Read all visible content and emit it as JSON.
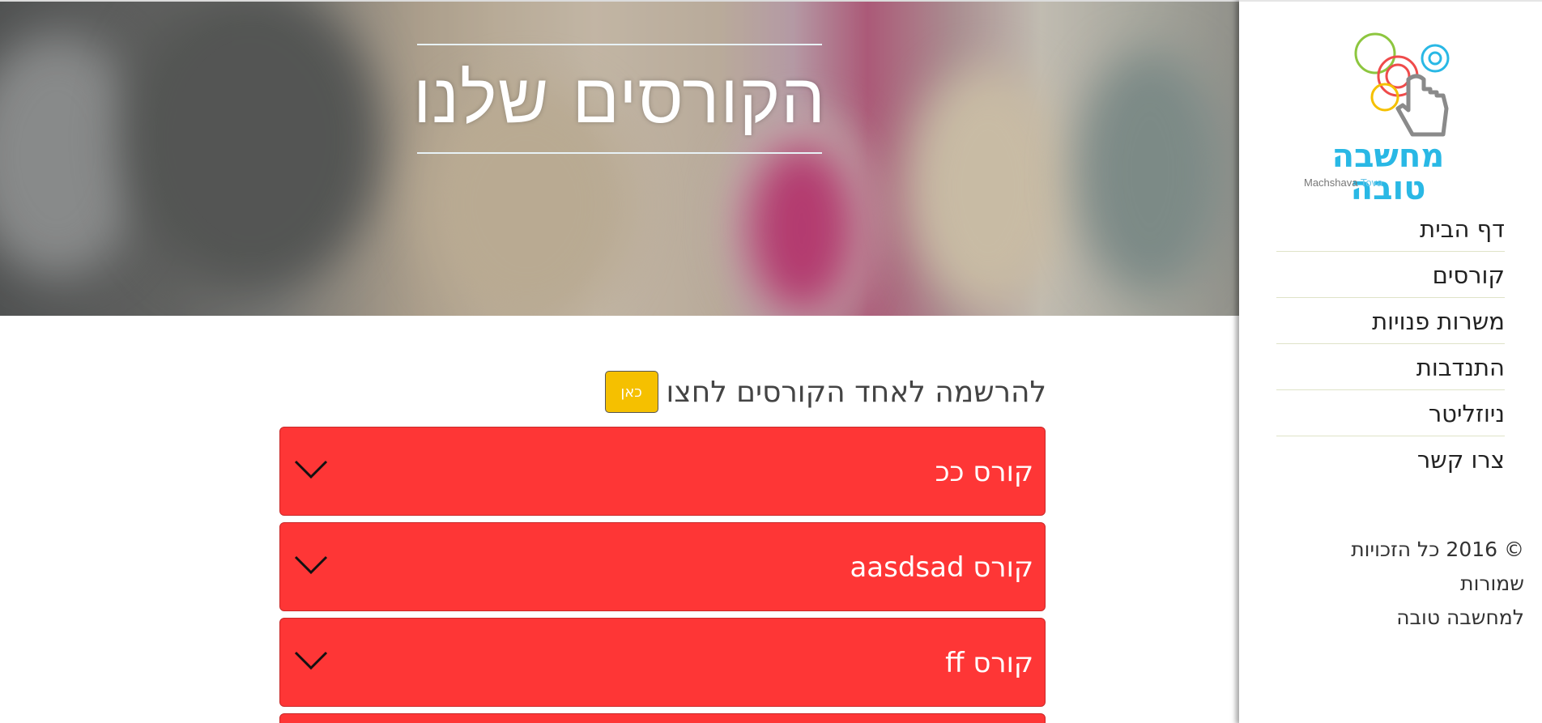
{
  "hero": {
    "title": "הקורסים שלנו"
  },
  "sidebar": {
    "logo": {
      "hebrew": "מחשבה טובה",
      "english_main": "Machshava",
      "english_accent": "Tova"
    },
    "nav": [
      {
        "label": "דף הבית"
      },
      {
        "label": "קורסים"
      },
      {
        "label": "משרות פנויות"
      },
      {
        "label": "התנדבות"
      },
      {
        "label": "ניוזליטר"
      },
      {
        "label": "צרו קשר"
      }
    ],
    "copyright_line1": "© 2016 כל הזכויות שמורות",
    "copyright_line2": "למחשבה טובה"
  },
  "main": {
    "register_text": "להרשמה לאחד הקורסים לחצו",
    "here_button": "כאן",
    "courses": [
      {
        "label": "קורס ככ"
      },
      {
        "label": "קורס aasdsad"
      },
      {
        "label": "קורס ff"
      }
    ]
  },
  "colors": {
    "course_bg": "#fe3636",
    "here_button": "#f5c000",
    "logo_blue": "#29b8e5"
  }
}
